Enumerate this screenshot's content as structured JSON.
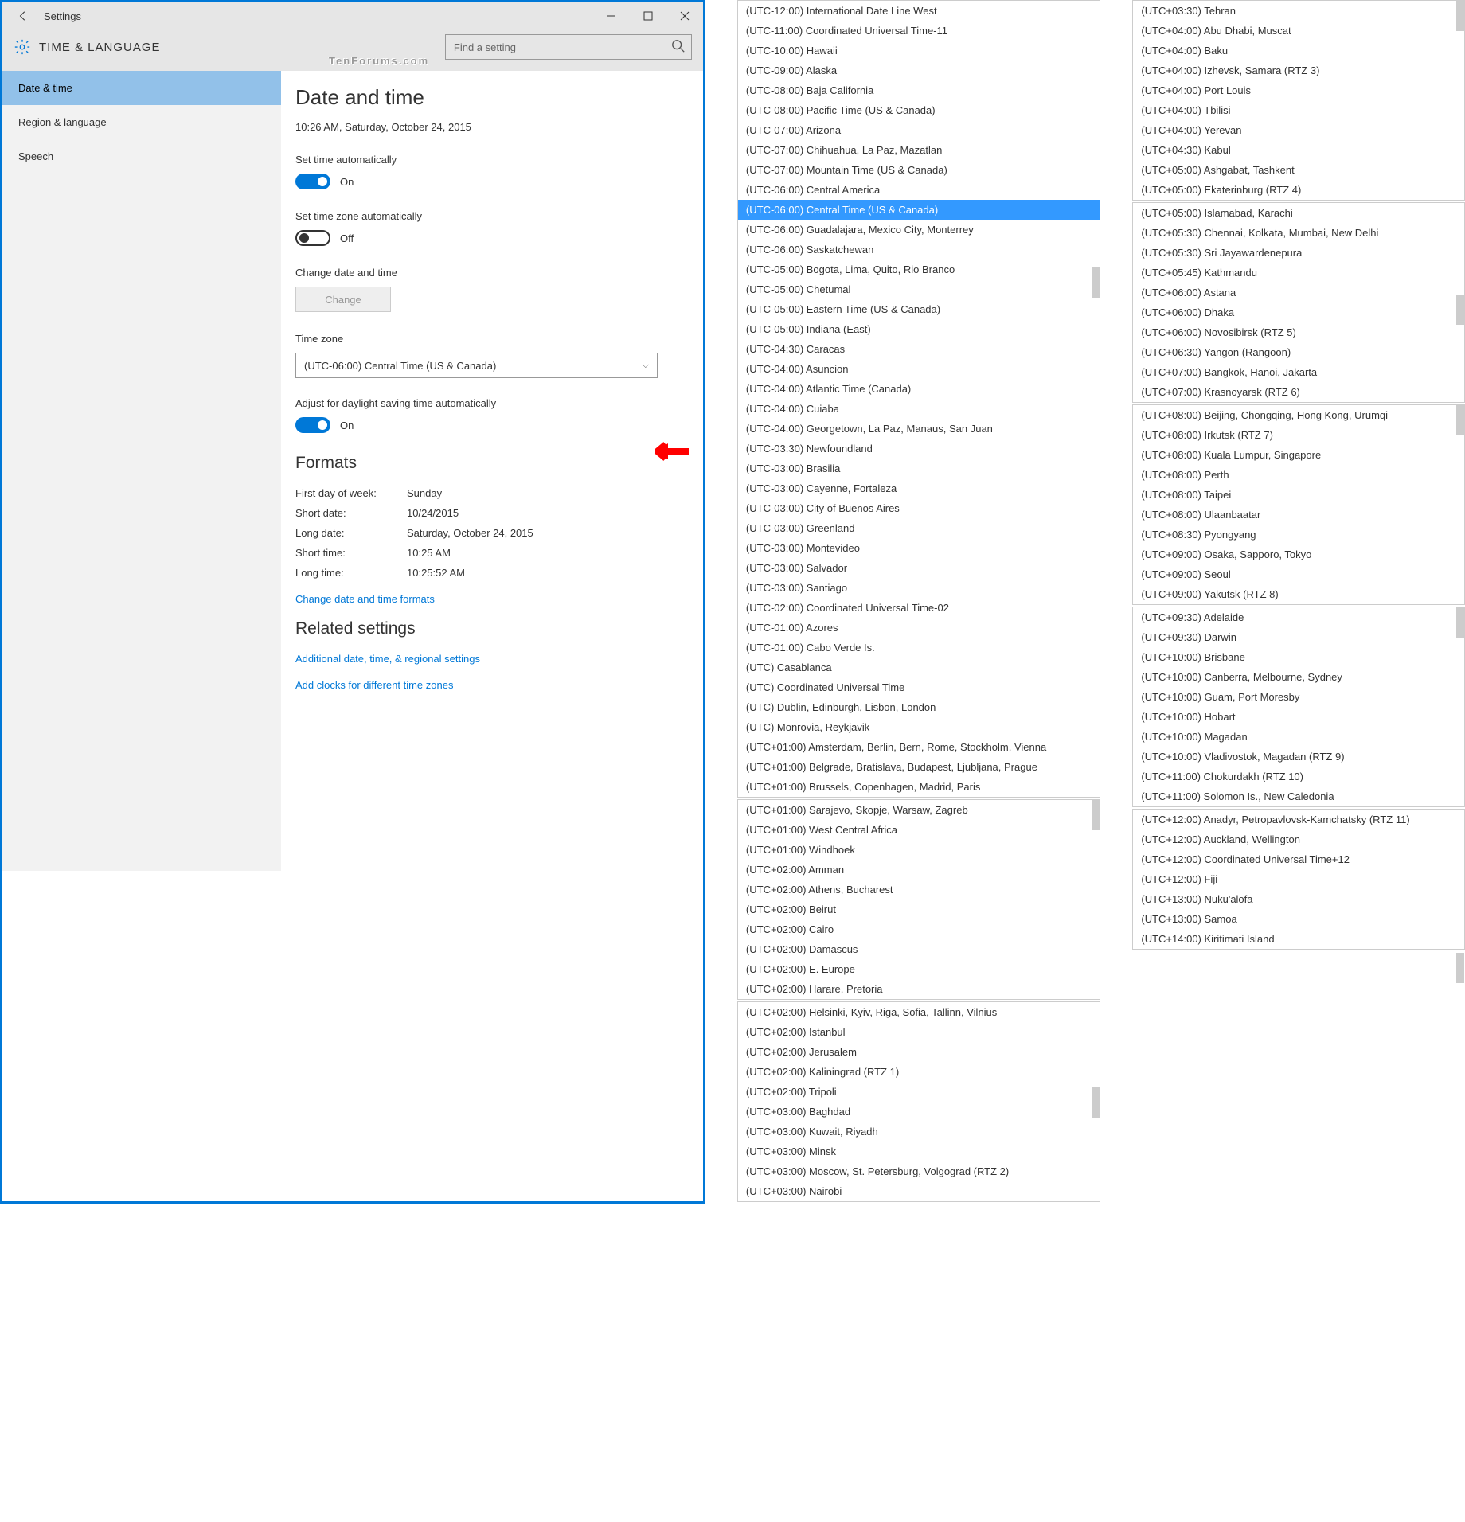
{
  "titlebar": {
    "title": "Settings"
  },
  "breadcrumb": {
    "title": "TIME & LANGUAGE"
  },
  "search": {
    "placeholder": "Find a setting"
  },
  "watermark": "TenForums.com",
  "sidebar": {
    "items": [
      {
        "label": "Date & time",
        "selected": true
      },
      {
        "label": "Region & language",
        "selected": false
      },
      {
        "label": "Speech",
        "selected": false
      }
    ]
  },
  "header": {
    "title": "Date and time"
  },
  "currentTime": "10:26 AM, Saturday, October 24, 2015",
  "autoTime": {
    "label": "Set time automatically",
    "state": "On"
  },
  "autoTz": {
    "label": "Set time zone automatically",
    "state": "Off"
  },
  "changeDate": {
    "label": "Change date and time",
    "button": "Change"
  },
  "timezone": {
    "label": "Time zone",
    "value": "(UTC-06:00) Central Time (US & Canada)"
  },
  "dst": {
    "label": "Adjust for daylight saving time automatically",
    "state": "On"
  },
  "formats": {
    "title": "Formats",
    "firstDayLabel": "First day of week:",
    "firstDay": "Sunday",
    "shortDateLabel": "Short date:",
    "shortDate": "10/24/2015",
    "longDateLabel": "Long date:",
    "longDate": "Saturday, October 24, 2015",
    "shortTimeLabel": "Short time:",
    "shortTime": "10:25 AM",
    "longTimeLabel": "Long time:",
    "longTime": "10:25:52 AM",
    "changeLink": "Change date and time formats"
  },
  "related": {
    "title": "Related settings",
    "additional": "Additional date, time, & regional settings",
    "addClocks": "Add clocks for different time zones"
  },
  "tzPane1": [
    "(UTC-12:00) International Date Line West",
    "(UTC-11:00) Coordinated Universal Time-11",
    "(UTC-10:00) Hawaii",
    "(UTC-09:00) Alaska",
    "(UTC-08:00) Baja California",
    "(UTC-08:00) Pacific Time (US & Canada)",
    "(UTC-07:00) Arizona",
    "(UTC-07:00) Chihuahua, La Paz, Mazatlan",
    "(UTC-07:00) Mountain Time (US & Canada)",
    "(UTC-06:00) Central America",
    "(UTC-06:00) Central Time (US & Canada)",
    "(UTC-06:00) Guadalajara, Mexico City, Monterrey",
    "(UTC-06:00) Saskatchewan",
    "(UTC-05:00) Bogota, Lima, Quito, Rio Branco",
    "(UTC-05:00) Chetumal",
    "(UTC-05:00) Eastern Time (US & Canada)",
    "(UTC-05:00) Indiana (East)",
    "(UTC-04:30) Caracas",
    "(UTC-04:00) Asuncion",
    "(UTC-04:00) Atlantic Time (Canada)",
    "(UTC-04:00) Cuiaba",
    "(UTC-04:00) Georgetown, La Paz, Manaus, San Juan",
    "(UTC-03:30) Newfoundland",
    "(UTC-03:00) Brasilia",
    "(UTC-03:00) Cayenne, Fortaleza",
    "(UTC-03:00) City of Buenos Aires",
    "(UTC-03:00) Greenland",
    "(UTC-03:00) Montevideo",
    "(UTC-03:00) Salvador",
    "(UTC-03:00) Santiago",
    "(UTC-02:00) Coordinated Universal Time-02",
    "(UTC-01:00) Azores",
    "(UTC-01:00) Cabo Verde Is.",
    "(UTC) Casablanca",
    "(UTC) Coordinated Universal Time",
    "(UTC) Dublin, Edinburgh, Lisbon, London",
    "(UTC) Monrovia, Reykjavik",
    "(UTC+01:00) Amsterdam, Berlin, Bern, Rome, Stockholm, Vienna",
    "(UTC+01:00) Belgrade, Bratislava, Budapest, Ljubljana, Prague",
    "(UTC+01:00) Brussels, Copenhagen, Madrid, Paris"
  ],
  "tzPane2": [
    "(UTC+01:00) Sarajevo, Skopje, Warsaw, Zagreb",
    "(UTC+01:00) West Central Africa",
    "(UTC+01:00) Windhoek",
    "(UTC+02:00) Amman",
    "(UTC+02:00) Athens, Bucharest",
    "(UTC+02:00) Beirut",
    "(UTC+02:00) Cairo",
    "(UTC+02:00) Damascus",
    "(UTC+02:00) E. Europe",
    "(UTC+02:00) Harare, Pretoria"
  ],
  "tzPane3": [
    "(UTC+02:00) Helsinki, Kyiv, Riga, Sofia, Tallinn, Vilnius",
    "(UTC+02:00) Istanbul",
    "(UTC+02:00) Jerusalem",
    "(UTC+02:00) Kaliningrad (RTZ 1)",
    "(UTC+02:00) Tripoli",
    "(UTC+03:00) Baghdad",
    "(UTC+03:00) Kuwait, Riyadh",
    "(UTC+03:00) Minsk",
    "(UTC+03:00) Moscow, St. Petersburg, Volgograd (RTZ 2)",
    "(UTC+03:00) Nairobi"
  ],
  "tzPane4": [
    "(UTC+03:30) Tehran",
    "(UTC+04:00) Abu Dhabi, Muscat",
    "(UTC+04:00) Baku",
    "(UTC+04:00) Izhevsk, Samara (RTZ 3)",
    "(UTC+04:00) Port Louis",
    "(UTC+04:00) Tbilisi",
    "(UTC+04:00) Yerevan",
    "(UTC+04:30) Kabul",
    "(UTC+05:00) Ashgabat, Tashkent",
    "(UTC+05:00) Ekaterinburg (RTZ 4)"
  ],
  "tzPane5": [
    "(UTC+05:00) Islamabad, Karachi",
    "(UTC+05:30) Chennai, Kolkata, Mumbai, New Delhi",
    "(UTC+05:30) Sri Jayawardenepura",
    "(UTC+05:45) Kathmandu",
    "(UTC+06:00) Astana",
    "(UTC+06:00) Dhaka",
    "(UTC+06:00) Novosibirsk (RTZ 5)",
    "(UTC+06:30) Yangon (Rangoon)",
    "(UTC+07:00) Bangkok, Hanoi, Jakarta",
    "(UTC+07:00) Krasnoyarsk (RTZ 6)"
  ],
  "tzPane6": [
    "(UTC+08:00) Beijing, Chongqing, Hong Kong, Urumqi",
    "(UTC+08:00) Irkutsk (RTZ 7)",
    "(UTC+08:00) Kuala Lumpur, Singapore",
    "(UTC+08:00) Perth",
    "(UTC+08:00) Taipei",
    "(UTC+08:00) Ulaanbaatar",
    "(UTC+08:30) Pyongyang",
    "(UTC+09:00) Osaka, Sapporo, Tokyo",
    "(UTC+09:00) Seoul",
    "(UTC+09:00) Yakutsk (RTZ 8)"
  ],
  "tzPane7": [
    "(UTC+09:30) Adelaide",
    "(UTC+09:30) Darwin",
    "(UTC+10:00) Brisbane",
    "(UTC+10:00) Canberra, Melbourne, Sydney",
    "(UTC+10:00) Guam, Port Moresby",
    "(UTC+10:00) Hobart",
    "(UTC+10:00) Magadan",
    "(UTC+10:00) Vladivostok, Magadan (RTZ 9)",
    "(UTC+11:00) Chokurdakh (RTZ 10)",
    "(UTC+11:00) Solomon Is., New Caledonia"
  ],
  "tzPane8": [
    "(UTC+12:00) Anadyr, Petropavlovsk-Kamchatsky (RTZ 11)",
    "(UTC+12:00) Auckland, Wellington",
    "(UTC+12:00) Coordinated Universal Time+12",
    "(UTC+12:00) Fiji",
    "(UTC+13:00) Nuku'alofa",
    "(UTC+13:00) Samoa",
    "(UTC+14:00) Kiritimati Island"
  ]
}
